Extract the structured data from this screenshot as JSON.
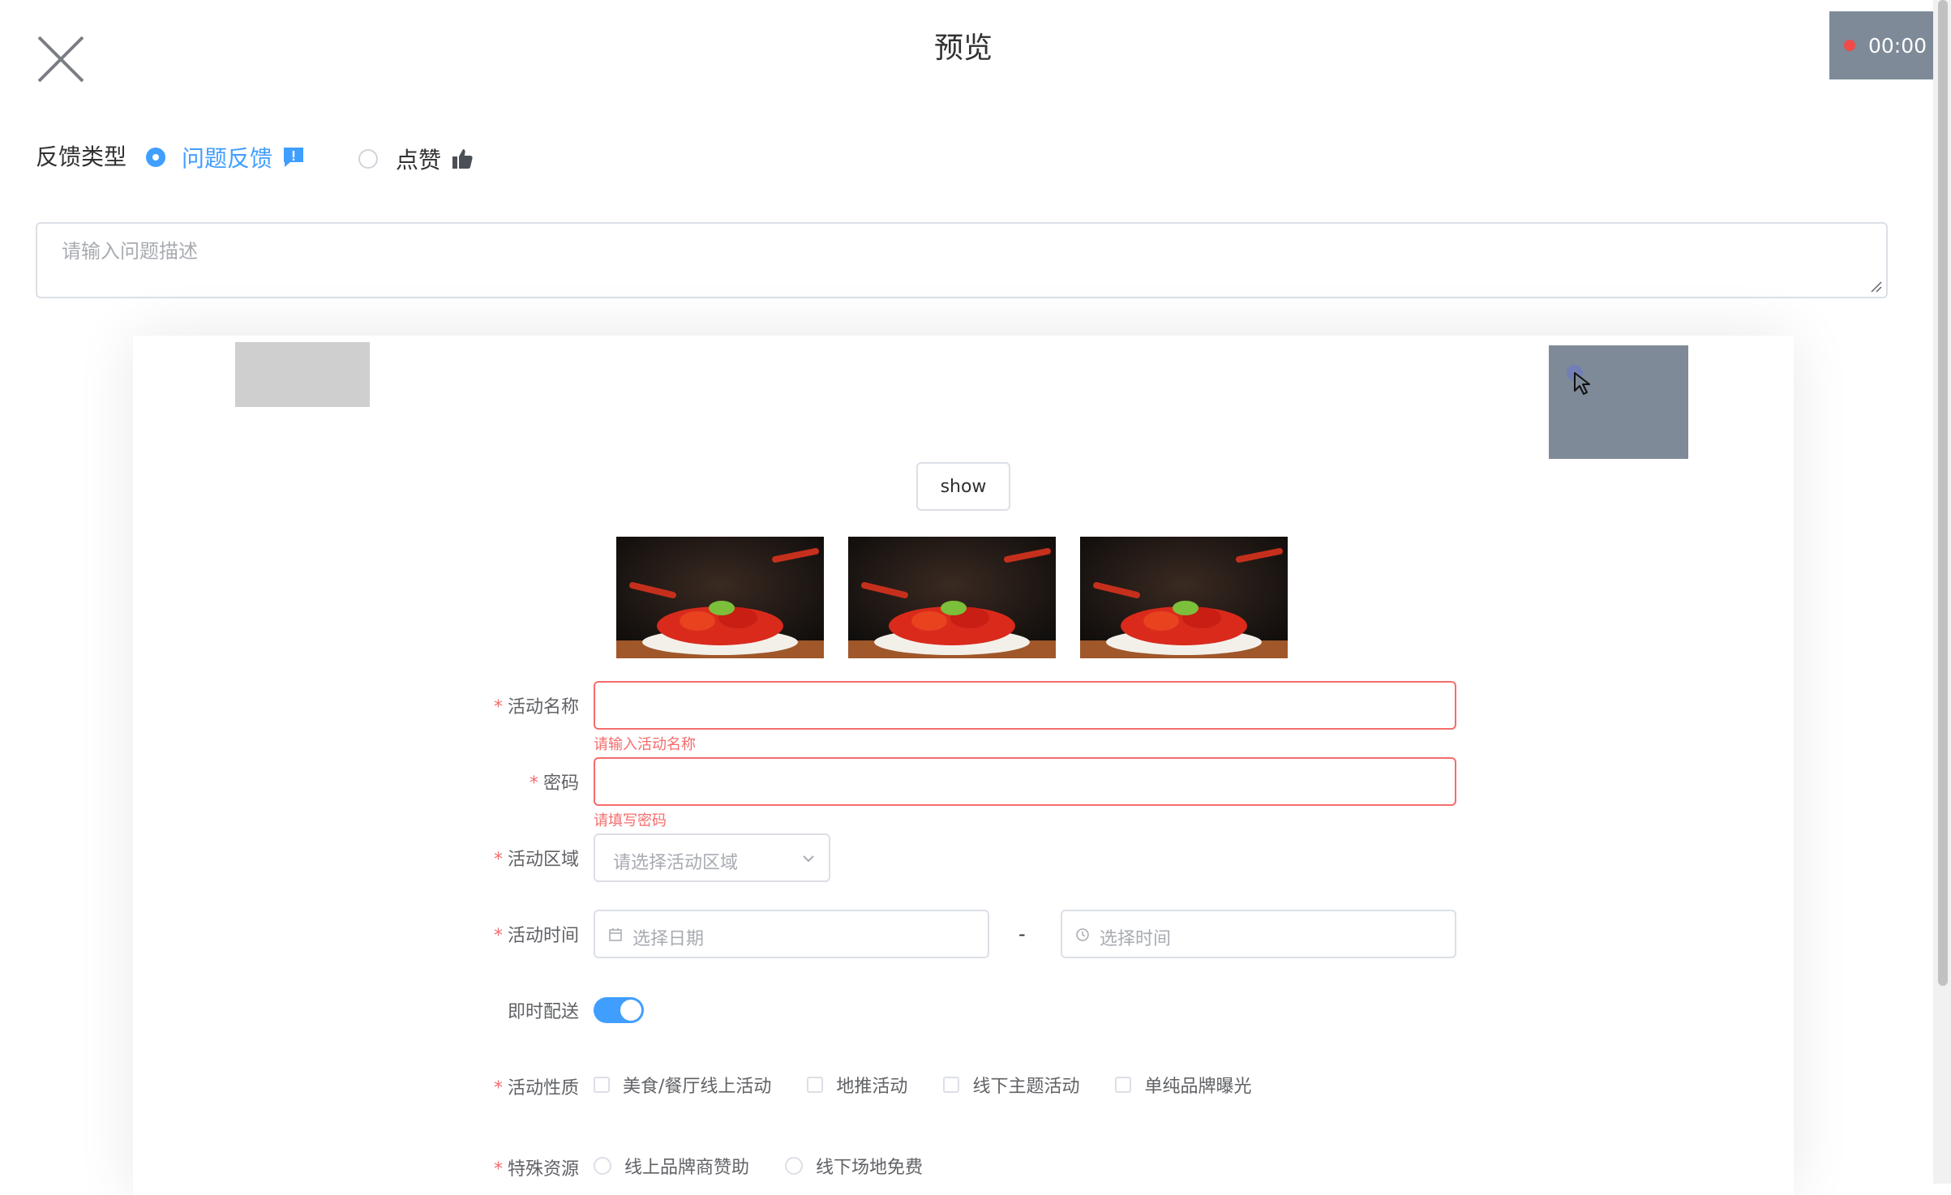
{
  "header": {
    "title": "预览",
    "recorder_time": "00:00"
  },
  "feedback": {
    "label": "反馈类型",
    "options": [
      {
        "label": "问题反馈",
        "selected": true
      },
      {
        "label": "点赞",
        "selected": false
      }
    ],
    "description_placeholder": "请输入问题描述"
  },
  "preview": {
    "show_button": "show",
    "images": [
      "crayfish-plate-image",
      "crayfish-plate-image",
      "crayfish-plate-image"
    ],
    "form": {
      "name": {
        "label": "活动名称",
        "required": true,
        "value": "",
        "error": "请输入活动名称"
      },
      "password": {
        "label": "密码",
        "required": true,
        "value": "",
        "error": "请填写密码"
      },
      "region": {
        "label": "活动区域",
        "required": true,
        "placeholder": "请选择活动区域"
      },
      "time": {
        "label": "活动时间",
        "required": true,
        "date_placeholder": "选择日期",
        "separator": "-",
        "time_placeholder": "选择时间"
      },
      "delivery": {
        "label": "即时配送",
        "required": false,
        "on": true
      },
      "nature": {
        "label": "活动性质",
        "required": true,
        "options": [
          "美食/餐厅线上活动",
          "地推活动",
          "线下主题活动",
          "单纯品牌曝光"
        ]
      },
      "resources": {
        "label": "特殊资源",
        "required": true,
        "options": [
          "线上品牌商赞助",
          "线下场地免费"
        ]
      }
    }
  },
  "colors": {
    "primary": "#409eff",
    "danger": "#f56c6c",
    "recorder_bg": "#7e8a97",
    "record_dot": "#f04b4b"
  }
}
